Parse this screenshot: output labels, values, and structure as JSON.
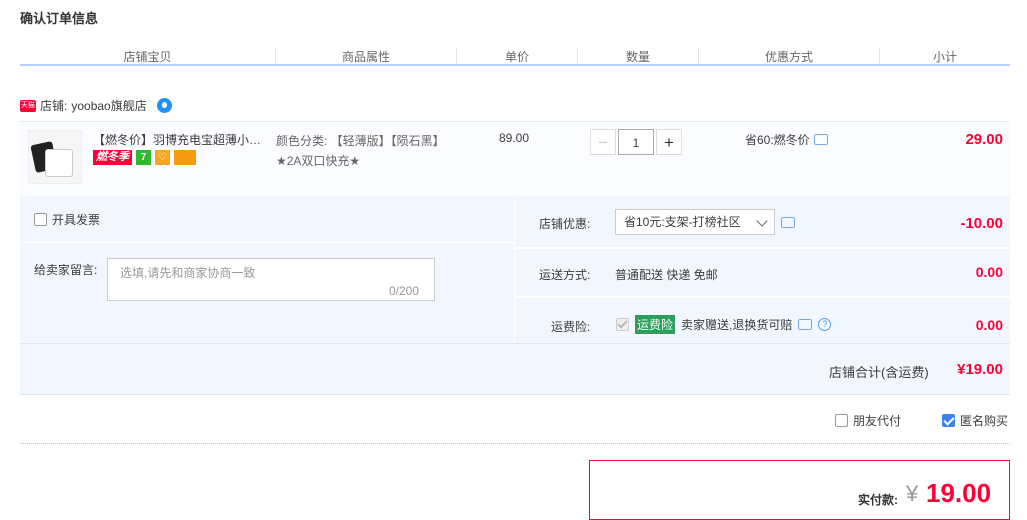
{
  "page": {
    "title": "确认订单信息"
  },
  "columns": [
    "店铺宝贝",
    "商品属性",
    "单价",
    "数量",
    "优惠方式",
    "小计"
  ],
  "shop": {
    "label": "店铺:",
    "name": "yoobao旗舰店",
    "badge": "天猫"
  },
  "item": {
    "name": "【燃冬价】羽博充电宝超薄小巧便携",
    "badge_label": "燃冬季",
    "attr_line1": "颜色分类: 【轻薄版】【陨石黑】",
    "attr_line2": "★2A双口快充★",
    "unit_price": "89.00",
    "quantity": "1",
    "qty_minus": "−",
    "qty_plus": "+",
    "discount": "省60:燃冬价",
    "subtotal": "29.00",
    "badge_7": "7",
    "badge_heart": "♡"
  },
  "options": {
    "invoice_label": "开具发票",
    "message_label": "给卖家留言:",
    "message_placeholder": "选填,请先和商家协商一致",
    "message_count": "0/200",
    "shop_discount_label": "店铺优惠:",
    "shop_discount_value": "省10元:支架-打榜社区",
    "shop_discount_amount": "-10.00",
    "shipping_label": "运送方式:",
    "shipping_value": "普通配送 快递 免邮",
    "shipping_price": "0.00",
    "insurance_label": "运费险:",
    "insurance_badge": "运费险",
    "insurance_text": "卖家赠送,退换货可赔",
    "insurance_price": "0.00",
    "help_icon": "?"
  },
  "total": {
    "label": "店铺合计(含运费)",
    "value": "¥19.00"
  },
  "extras": {
    "friend_pay": "朋友代付",
    "anonymous": "匿名购买",
    "anonymous_checked": true,
    "friend_checked": false
  },
  "payment": {
    "label": "实付款:",
    "currency": "¥",
    "amount": "19.00"
  },
  "colors": {
    "accent_red": "#ff0036",
    "accent_blue": "#3d83ee",
    "panel_bg": "#f2f7ff"
  }
}
